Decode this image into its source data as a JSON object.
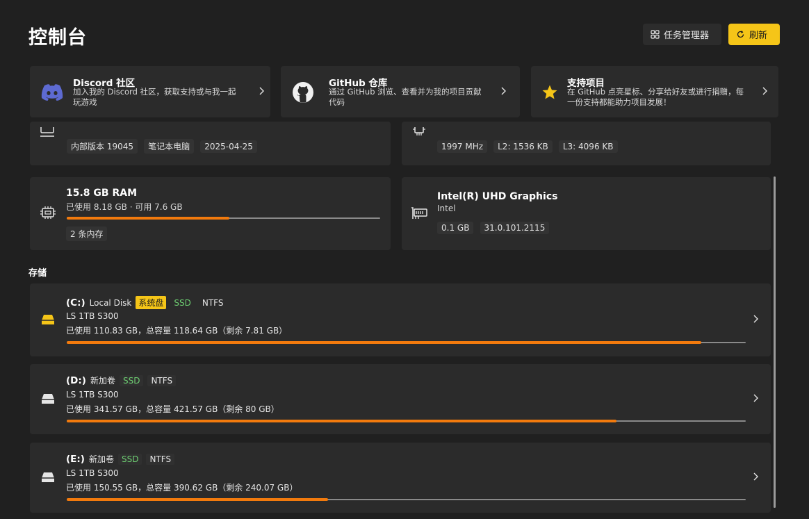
{
  "header": {
    "title": "控制台",
    "task_manager_label": "任务管理器",
    "refresh_label": "刷新"
  },
  "links": [
    {
      "title": "Discord 社区",
      "desc_line1": "加入我的 Discord 社区，获取支持或与我一起",
      "desc_line2": "玩游戏",
      "icon": "discord-icon"
    },
    {
      "title": "GitHub 仓库",
      "desc_line1": "通过 GitHub 浏览、查看并为我的项目贡献",
      "desc_line2": "代码",
      "icon": "github-icon"
    },
    {
      "title": "支持项目",
      "desc_line1": "在 GitHub 点亮星标、分享给好友或进行捐赠，每",
      "desc_line2": "一份支持都能助力项目发展！",
      "icon": "star-icon"
    }
  ],
  "os": {
    "chips": [
      "内部版本 19045",
      "笔记本电脑",
      "2025-04-25"
    ]
  },
  "cpu": {
    "chips": [
      "1997 MHz",
      "L2: 1536 KB",
      "L3: 4096 KB"
    ]
  },
  "ram": {
    "title": "15.8 GB RAM",
    "subtitle": "已使用 8.18 GB · 可用 7.6 GB",
    "used_fraction": 0.518,
    "chips": [
      "2 条内存"
    ]
  },
  "gpu": {
    "title": "Intel(R) UHD Graphics",
    "vendor": "Intel",
    "chips": [
      "0.1 GB",
      "31.0.101.2115"
    ]
  },
  "storage": {
    "section_title": "存储",
    "disks": [
      {
        "letter": "(C:)",
        "name": "Local Disk",
        "system_tag": "系统盘",
        "type": "SSD",
        "fs": "NTFS",
        "model": "LS 1TB S300",
        "usage": "已使用 110.83 GB，总容量 118.64 GB（剩余 7.81 GB）",
        "used_fraction": 0.934,
        "icon_color": "#f5c518"
      },
      {
        "letter": "(D:)",
        "name": "新加卷",
        "system_tag": "",
        "type": "SSD",
        "fs": "NTFS",
        "model": "LS 1TB S300",
        "usage": "已使用 341.57 GB，总容量 421.57 GB（剩余 80 GB）",
        "used_fraction": 0.81,
        "icon_color": "#e6e6e6"
      },
      {
        "letter": "(E:)",
        "name": "新加卷",
        "system_tag": "",
        "type": "SSD",
        "fs": "NTFS",
        "model": "LS 1TB S300",
        "usage": "已使用 150.55 GB，总容量 390.62 GB（剩余 240.07 GB）",
        "used_fraction": 0.385,
        "icon_color": "#e6e6e6"
      }
    ]
  },
  "colors": {
    "accent": "#f5c518",
    "progress": "#f27a0d",
    "ssd_tag": "#6ecf72"
  }
}
